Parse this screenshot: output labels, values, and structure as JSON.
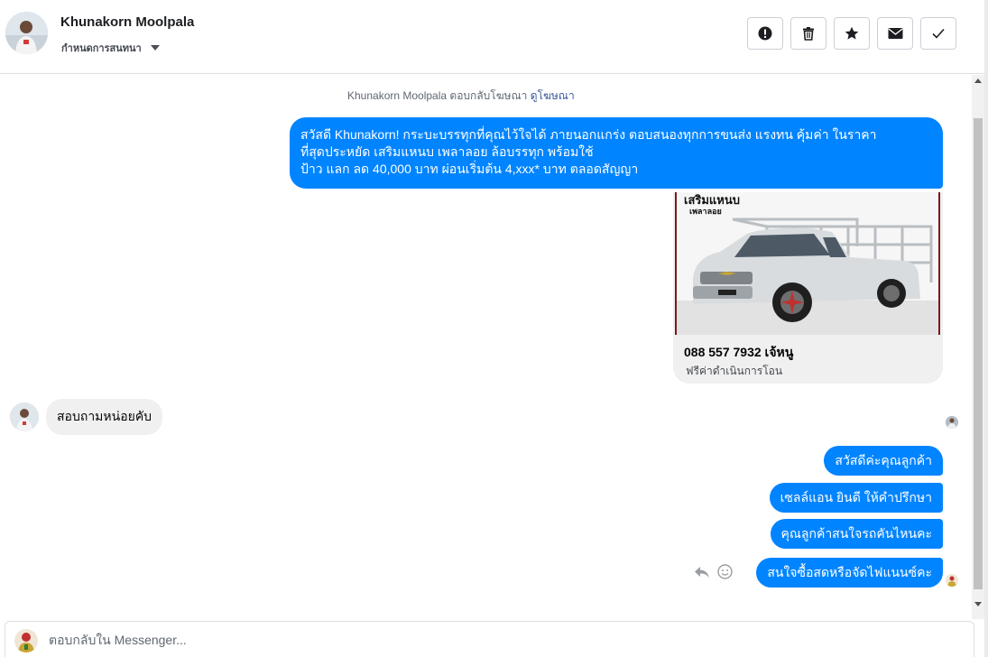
{
  "header": {
    "contact_name": "Khunakorn Moolpala",
    "conversation_settings": "กำหนดการสนทนา",
    "actions": [
      {
        "name": "report",
        "icon": "exclamation-icon"
      },
      {
        "name": "delete",
        "icon": "trash-icon"
      },
      {
        "name": "star",
        "icon": "star-icon"
      },
      {
        "name": "mark-unread",
        "icon": "envelope-icon"
      },
      {
        "name": "mark-done",
        "icon": "check-icon"
      }
    ]
  },
  "thread": {
    "ad_notice": {
      "prefix": "Khunakorn Moolpala ตอบกลับโฆษณา",
      "link": "ดูโฆษณา"
    },
    "ad_message": {
      "lines": [
        "สวัสดี Khunakorn! กระบะบรรทุกที่คุณไว้ใจได้ ภายนอกแกร่ง ตอบสนองทุกการขนส่ง แรงทน คุ้มค่า ในราคา",
        "ที่สุดประหยัด เสริมแหนบ เพลาลอย ล้อบรรทุก พร้อมใช้",
        "ป้าว แลก ลด 40,000 บาท ผ่อนเริ่มต้น 4,xxx* บาท ตลอดสัญญา"
      ]
    },
    "ad_card": {
      "image_text_1": "เสริมแหนบ",
      "image_text_2": "เพลาลอย",
      "title": "088 557 7932 เจ้หนู",
      "subtitle": "ฟรีค่าดำเนินการโอน"
    },
    "incoming_message": "สอบถามหน่อยคับ",
    "outgoing_messages": [
      "สวัสดีค่ะคุณลูกค้า",
      "เซลล์แอน ยินดี ให้คำปรึกษา",
      "คุณลูกค้าสนใจรถคันไหนคะ",
      "สนใจซื้อสดหรือจัดไฟแนนซ์คะ"
    ]
  },
  "composer": {
    "placeholder": "ตอบกลับใน Messenger..."
  },
  "colors": {
    "accent": "#0084ff",
    "incoming_bubble": "#f1f0f0",
    "link": "#385898"
  }
}
